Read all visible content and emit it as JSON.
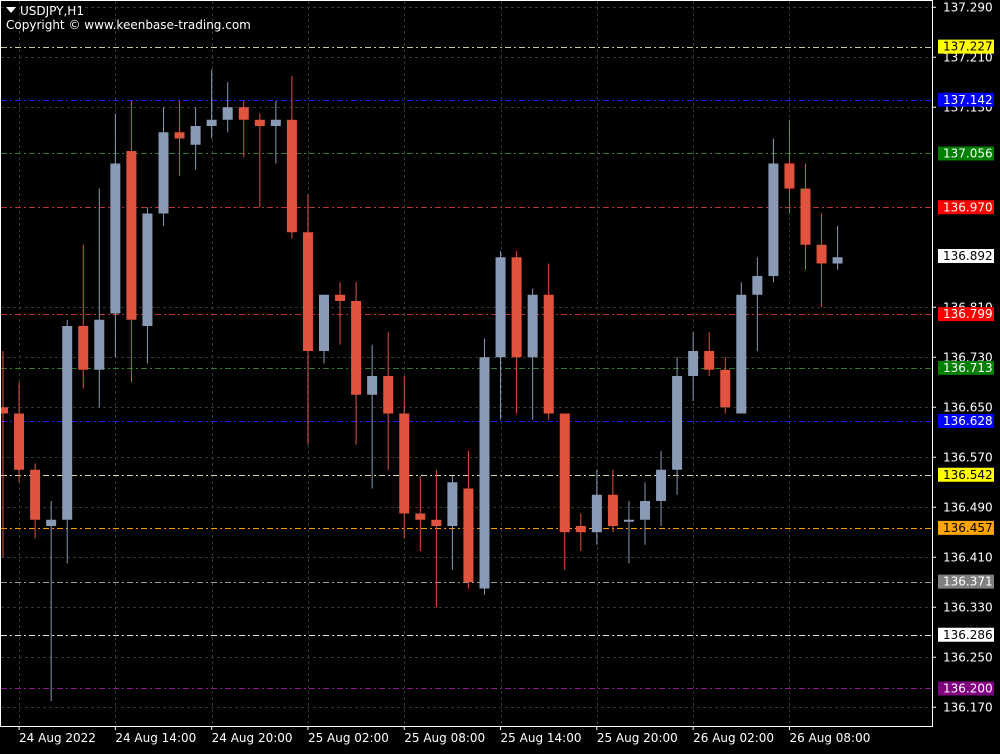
{
  "header": {
    "symbol": "USDJPY,H1",
    "copyright": "Copyright © www.keenbase-trading.com"
  },
  "colors": {
    "background": "#000000",
    "frame": "#ffffff",
    "grid": "#2f3a2f",
    "bull": "#8a9ab5",
    "bear": "#e0533f",
    "text": "#ffffff"
  },
  "chart_data": {
    "type": "candlestick",
    "title": "",
    "symbol": "USDJPY",
    "timeframe": "H1",
    "ylim": [
      136.14,
      137.3
    ],
    "grid": true,
    "y_ticks": [
      "137.290",
      "137.210",
      "137.130",
      "136.810",
      "136.730",
      "136.650",
      "136.570",
      "136.490",
      "136.410",
      "136.330",
      "136.250",
      "136.170"
    ],
    "x_ticks": [
      {
        "index": 1,
        "label": "24 Aug 2022"
      },
      {
        "index": 7,
        "label": "24 Aug 14:00"
      },
      {
        "index": 13,
        "label": "24 Aug 20:00"
      },
      {
        "index": 19,
        "label": "25 Aug 02:00"
      },
      {
        "index": 25,
        "label": "25 Aug 08:00"
      },
      {
        "index": 31,
        "label": "25 Aug 14:00"
      },
      {
        "index": 37,
        "label": "25 Aug 20:00"
      },
      {
        "index": 43,
        "label": "26 Aug 02:00"
      },
      {
        "index": 49,
        "label": "26 Aug 08:00"
      }
    ],
    "levels": [
      {
        "price": "137.227",
        "line_color": "#c8c8a0",
        "label_bg": "#ffff00",
        "label_fg": "#000000"
      },
      {
        "price": "137.142",
        "line_color": "#2020ff",
        "label_bg": "#0000ff",
        "label_fg": "#ffffff"
      },
      {
        "price": "137.056",
        "line_color": "#2f7a2f",
        "label_bg": "#008000",
        "label_fg": "#ffffff"
      },
      {
        "price": "136.970",
        "line_color": "#c03030",
        "label_bg": "#ff0000",
        "label_fg": "#ffffff"
      },
      {
        "price": "136.892",
        "line_color": "",
        "label_bg": "#ffffff",
        "label_fg": "#000000"
      },
      {
        "price": "136.799",
        "line_color": "#c03030",
        "label_bg": "#ff0000",
        "label_fg": "#ffffff"
      },
      {
        "price": "136.713",
        "line_color": "#2f7a2f",
        "label_bg": "#008000",
        "label_fg": "#ffffff"
      },
      {
        "price": "136.628",
        "line_color": "#2020ff",
        "label_bg": "#0000ff",
        "label_fg": "#ffffff"
      },
      {
        "price": "136.542",
        "line_color": "#d8d8b0",
        "label_bg": "#ffff00",
        "label_fg": "#000000"
      },
      {
        "price": "136.457",
        "line_color": "#ff9900",
        "label_bg": "#ffa500",
        "label_fg": "#000000"
      },
      {
        "price": "136.371",
        "line_color": "#9a9a9a",
        "label_bg": "#808080",
        "label_fg": "#ffffff"
      },
      {
        "price": "136.286",
        "line_color": "#e0e0e0",
        "label_bg": "#ffffff",
        "label_fg": "#000000"
      },
      {
        "price": "136.200",
        "line_color": "#8b1a8b",
        "label_bg": "#800080",
        "label_fg": "#ffffff"
      }
    ],
    "candles": [
      {
        "o": 136.65,
        "h": 136.74,
        "l": 136.41,
        "c": 136.64
      },
      {
        "o": 136.64,
        "h": 136.69,
        "l": 136.53,
        "c": 136.55
      },
      {
        "o": 136.55,
        "h": 136.56,
        "l": 136.44,
        "c": 136.47
      },
      {
        "o": 136.46,
        "h": 136.5,
        "l": 136.18,
        "c": 136.47
      },
      {
        "o": 136.47,
        "h": 136.79,
        "l": 136.4,
        "c": 136.78
      },
      {
        "o": 136.78,
        "h": 136.91,
        "l": 136.68,
        "c": 136.71
      },
      {
        "o": 136.71,
        "h": 137.0,
        "l": 136.65,
        "c": 136.79
      },
      {
        "o": 136.8,
        "h": 137.12,
        "l": 136.73,
        "c": 137.04
      },
      {
        "o": 137.06,
        "h": 137.14,
        "l": 136.69,
        "c": 136.79
      },
      {
        "o": 136.78,
        "h": 136.97,
        "l": 136.72,
        "c": 136.96
      },
      {
        "o": 136.96,
        "h": 137.13,
        "l": 136.94,
        "c": 137.09
      },
      {
        "o": 137.09,
        "h": 137.14,
        "l": 137.02,
        "c": 137.08
      },
      {
        "o": 137.07,
        "h": 137.13,
        "l": 137.03,
        "c": 137.1
      },
      {
        "o": 137.1,
        "h": 137.19,
        "l": 137.08,
        "c": 137.11
      },
      {
        "o": 137.11,
        "h": 137.17,
        "l": 137.09,
        "c": 137.13
      },
      {
        "o": 137.13,
        "h": 137.14,
        "l": 137.05,
        "c": 137.11
      },
      {
        "o": 137.11,
        "h": 137.12,
        "l": 136.97,
        "c": 137.1
      },
      {
        "o": 137.1,
        "h": 137.14,
        "l": 137.04,
        "c": 137.11
      },
      {
        "o": 137.11,
        "h": 137.18,
        "l": 136.92,
        "c": 136.93
      },
      {
        "o": 136.93,
        "h": 136.99,
        "l": 136.59,
        "c": 136.74
      },
      {
        "o": 136.74,
        "h": 136.83,
        "l": 136.72,
        "c": 136.83
      },
      {
        "o": 136.83,
        "h": 136.85,
        "l": 136.75,
        "c": 136.82
      },
      {
        "o": 136.82,
        "h": 136.85,
        "l": 136.59,
        "c": 136.67
      },
      {
        "o": 136.67,
        "h": 136.75,
        "l": 136.52,
        "c": 136.7
      },
      {
        "o": 136.7,
        "h": 136.77,
        "l": 136.55,
        "c": 136.64
      },
      {
        "o": 136.64,
        "h": 136.7,
        "l": 136.44,
        "c": 136.48
      },
      {
        "o": 136.48,
        "h": 136.54,
        "l": 136.42,
        "c": 136.47
      },
      {
        "o": 136.47,
        "h": 136.55,
        "l": 136.33,
        "c": 136.46
      },
      {
        "o": 136.46,
        "h": 136.54,
        "l": 136.39,
        "c": 136.53
      },
      {
        "o": 136.52,
        "h": 136.58,
        "l": 136.36,
        "c": 136.37
      },
      {
        "o": 136.36,
        "h": 136.76,
        "l": 136.35,
        "c": 136.73
      },
      {
        "o": 136.73,
        "h": 136.9,
        "l": 136.63,
        "c": 136.89
      },
      {
        "o": 136.89,
        "h": 136.9,
        "l": 136.64,
        "c": 136.73
      },
      {
        "o": 136.73,
        "h": 136.84,
        "l": 136.63,
        "c": 136.83
      },
      {
        "o": 136.83,
        "h": 136.88,
        "l": 136.63,
        "c": 136.64
      },
      {
        "o": 136.64,
        "h": 136.64,
        "l": 136.39,
        "c": 136.45
      },
      {
        "o": 136.46,
        "h": 136.48,
        "l": 136.42,
        "c": 136.45
      },
      {
        "o": 136.45,
        "h": 136.55,
        "l": 136.43,
        "c": 136.51
      },
      {
        "o": 136.51,
        "h": 136.55,
        "l": 136.45,
        "c": 136.46
      },
      {
        "o": 136.47,
        "h": 136.5,
        "l": 136.4,
        "c": 136.47
      },
      {
        "o": 136.47,
        "h": 136.53,
        "l": 136.43,
        "c": 136.5
      },
      {
        "o": 136.5,
        "h": 136.58,
        "l": 136.46,
        "c": 136.55
      },
      {
        "o": 136.55,
        "h": 136.73,
        "l": 136.51,
        "c": 136.7
      },
      {
        "o": 136.7,
        "h": 136.77,
        "l": 136.66,
        "c": 136.74
      },
      {
        "o": 136.74,
        "h": 136.77,
        "l": 136.7,
        "c": 136.71
      },
      {
        "o": 136.71,
        "h": 136.73,
        "l": 136.64,
        "c": 136.65
      },
      {
        "o": 136.64,
        "h": 136.85,
        "l": 136.64,
        "c": 136.83
      },
      {
        "o": 136.83,
        "h": 136.89,
        "l": 136.74,
        "c": 136.86
      },
      {
        "o": 136.86,
        "h": 137.08,
        "l": 136.85,
        "c": 137.04
      },
      {
        "o": 137.04,
        "h": 137.11,
        "l": 136.96,
        "c": 137.0
      },
      {
        "o": 137.0,
        "h": 137.04,
        "l": 136.87,
        "c": 136.91
      },
      {
        "o": 136.91,
        "h": 136.96,
        "l": 136.81,
        "c": 136.88
      },
      {
        "o": 136.88,
        "h": 136.94,
        "l": 136.87,
        "c": 136.89
      }
    ]
  }
}
